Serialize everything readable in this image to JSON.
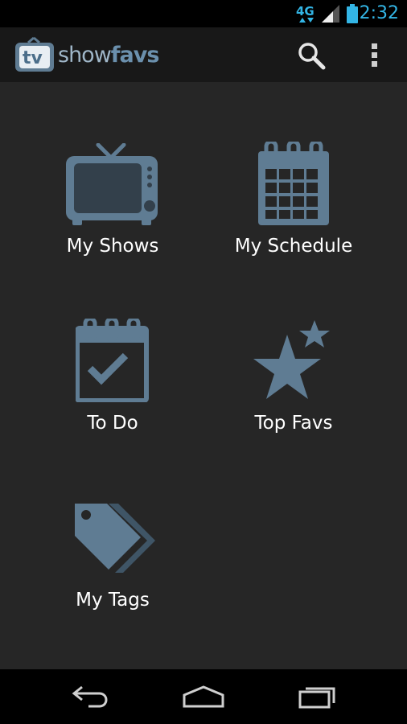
{
  "status_bar": {
    "network": "4G",
    "time": "2:32"
  },
  "action_bar": {
    "logo_tv": "tv",
    "logo_show": "show",
    "logo_favs": "favs",
    "search_icon": "search-icon",
    "overflow_icon": "overflow-menu-icon"
  },
  "menu": {
    "items": [
      {
        "label": "My Shows",
        "icon": "tv-icon"
      },
      {
        "label": "My Schedule",
        "icon": "calendar-icon"
      },
      {
        "label": "To Do",
        "icon": "checklist-calendar-icon"
      },
      {
        "label": "Top Favs",
        "icon": "star-icon"
      },
      {
        "label": "My Tags",
        "icon": "tag-icon"
      }
    ]
  },
  "nav_bar": {
    "back": "back-icon",
    "home": "home-icon",
    "recents": "recents-icon"
  },
  "colors": {
    "icon": "#5f7c93",
    "accent": "#33b5e5",
    "background": "#262626"
  }
}
